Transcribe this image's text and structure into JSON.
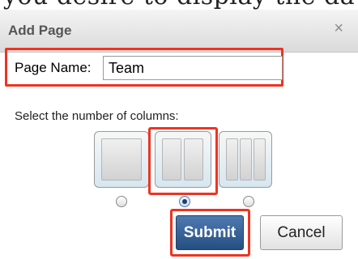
{
  "background": {
    "partial_text": "you desire to display the da"
  },
  "dialog": {
    "title": "Add Page",
    "close_glyph": "×",
    "page_name": {
      "label": "Page Name:",
      "value": "Team"
    },
    "columns": {
      "label": "Select the number of columns:",
      "options": [
        {
          "columns": 1,
          "selected": false
        },
        {
          "columns": 2,
          "selected": true
        },
        {
          "columns": 3,
          "selected": false
        }
      ]
    },
    "buttons": {
      "submit": "Submit",
      "cancel": "Cancel"
    }
  },
  "colors": {
    "highlight": "#ee3322",
    "submit_bg": "#2f5a8f",
    "title_text": "#555555"
  }
}
